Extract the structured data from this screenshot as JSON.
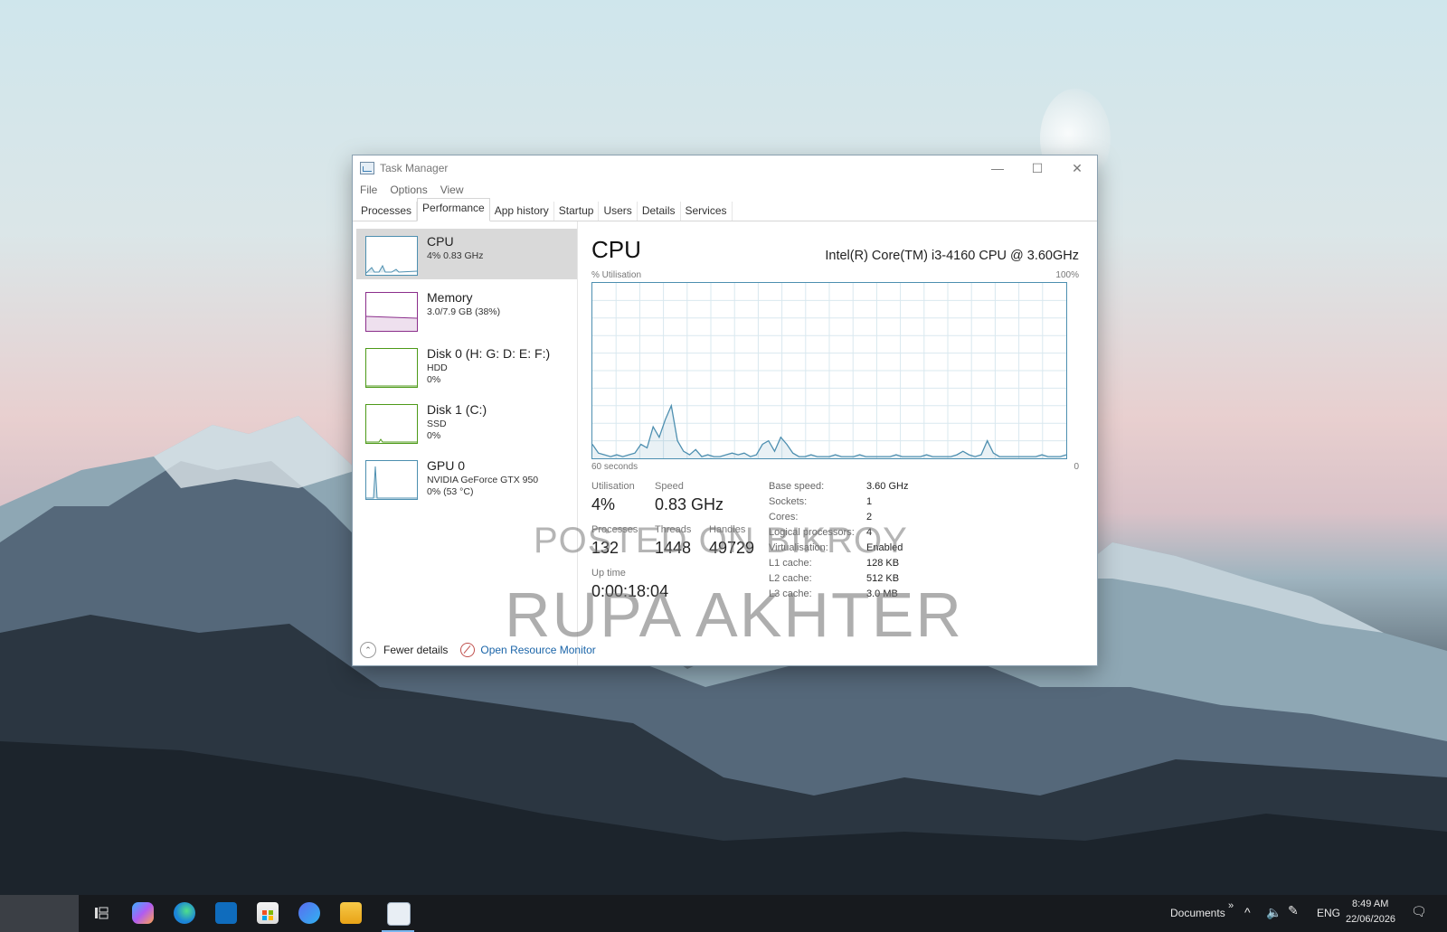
{
  "window": {
    "title": "Task Manager",
    "controls": {
      "minimize": "—",
      "maximize": "☐",
      "close": "✕"
    }
  },
  "menu": [
    "File",
    "Options",
    "View"
  ],
  "tabs": [
    "Processes",
    "Performance",
    "App history",
    "Startup",
    "Users",
    "Details",
    "Services"
  ],
  "active_tab": "Performance",
  "resources": [
    {
      "name": "CPU",
      "sub": "4% 0.83 GHz",
      "sub2": "",
      "color": "#4d8fb0",
      "icon": "cpu-graph-icon"
    },
    {
      "name": "Memory",
      "sub": "3.0/7.9 GB (38%)",
      "sub2": "",
      "color": "#8b2e8b",
      "icon": "memory-graph-icon"
    },
    {
      "name": "Disk 0 (H: G: D: E: F:)",
      "sub": "HDD",
      "sub2": "0%",
      "color": "#4d9a18",
      "icon": "disk-graph-icon"
    },
    {
      "name": "Disk 1 (C:)",
      "sub": "SSD",
      "sub2": "0%",
      "color": "#4d9a18",
      "icon": "disk-graph-icon"
    },
    {
      "name": "GPU 0",
      "sub": "NVIDIA GeForce GTX 950",
      "sub2": "0% (53 °C)",
      "color": "#4d8fb0",
      "icon": "gpu-graph-icon"
    }
  ],
  "cpu": {
    "title": "CPU",
    "model": "Intel(R) Core(TM) i3-4160 CPU @ 3.60GHz",
    "util_label": "% Utilisation",
    "util_max": "100%",
    "time_left": "60 seconds",
    "time_right": "0",
    "history_percent": [
      8,
      3,
      2,
      1,
      2,
      1,
      2,
      3,
      8,
      6,
      18,
      12,
      22,
      30,
      10,
      4,
      2,
      5,
      1,
      2,
      1,
      1,
      2,
      3,
      2,
      3,
      1,
      2,
      8,
      10,
      4,
      12,
      8,
      3,
      1,
      1,
      2,
      1,
      1,
      1,
      2,
      1,
      1,
      1,
      2,
      1,
      1,
      1,
      1,
      1,
      2,
      1,
      1,
      1,
      1,
      2,
      1,
      1,
      1,
      1,
      2,
      4,
      2,
      1,
      2,
      10,
      3,
      1,
      1,
      1,
      1,
      1,
      1,
      1,
      2,
      1,
      1,
      1,
      2
    ],
    "stats": {
      "utilisation_label": "Utilisation",
      "utilisation": "4%",
      "speed_label": "Speed",
      "speed": "0.83 GHz",
      "processes_label": "Processes",
      "processes": "132",
      "threads_label": "Threads",
      "threads": "1448",
      "handles_label": "Handles",
      "handles": "49729",
      "uptime_label": "Up time",
      "uptime": "0:00:18:04"
    },
    "specs": [
      {
        "k": "Base speed:",
        "v": "3.60 GHz"
      },
      {
        "k": "Sockets:",
        "v": "1"
      },
      {
        "k": "Cores:",
        "v": "2"
      },
      {
        "k": "Logical processors:",
        "v": "4"
      },
      {
        "k": "Virtualisation:",
        "v": "Enabled"
      },
      {
        "k": "L1 cache:",
        "v": "128 KB"
      },
      {
        "k": "L2 cache:",
        "v": "512 KB"
      },
      {
        "k": "L3 cache:",
        "v": "3.0 MB"
      }
    ]
  },
  "footer": {
    "fewer": "Fewer details",
    "open_rm": "Open Resource Monitor"
  },
  "watermark": {
    "line1": "POSTED ON BIKROY",
    "line2": "RUPA AKHTER"
  },
  "taskbar": {
    "apps": [
      "task-view-icon",
      "copilot-icon",
      "edge-icon",
      "outlook-icon",
      "store-icon",
      "media-player-icon",
      "file-explorer-icon",
      "task-manager-icon"
    ],
    "toolbar_label": "Documents",
    "language": "ENG",
    "time": "8:49 AM",
    "date": "22/06/2026"
  }
}
